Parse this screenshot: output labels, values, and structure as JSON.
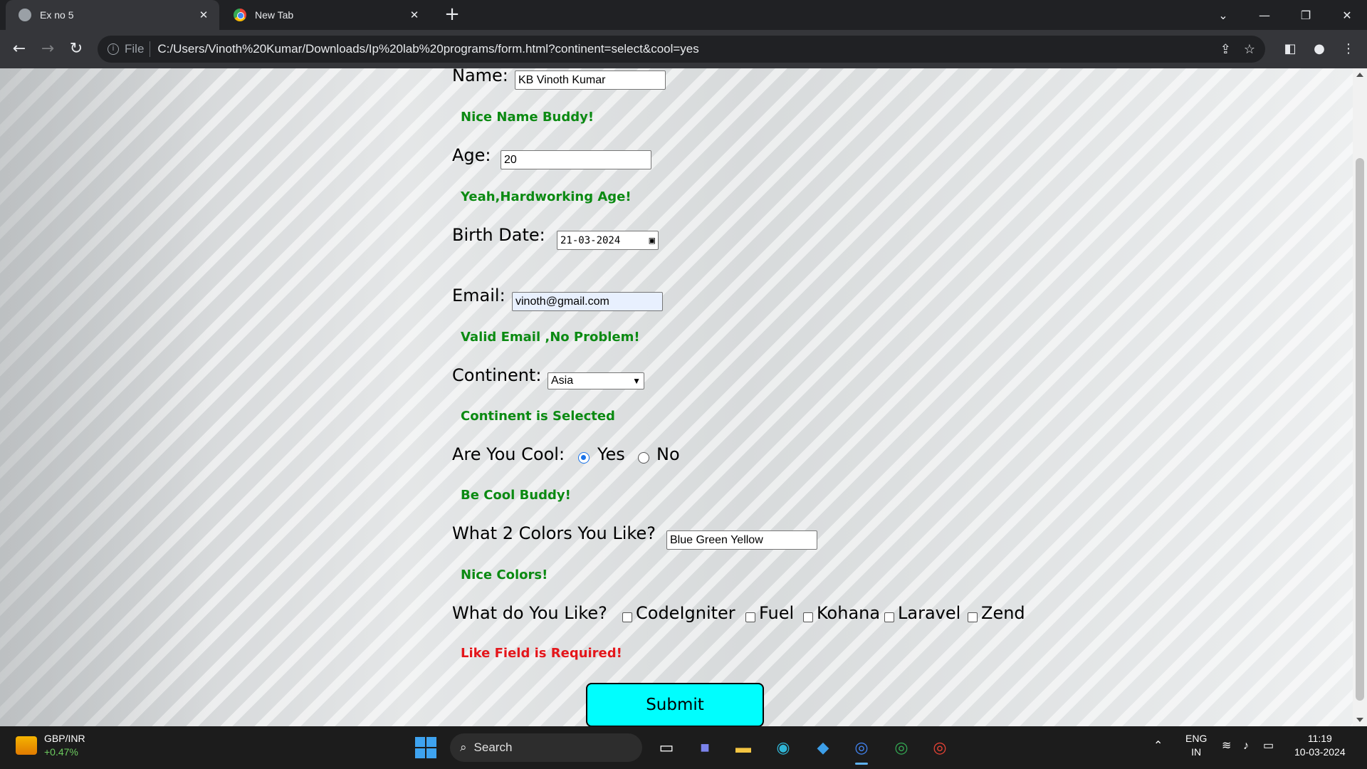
{
  "browser": {
    "tabs": [
      {
        "title": "Ex no 5",
        "active": true,
        "icon": "globe-icon"
      },
      {
        "title": "New Tab",
        "active": false,
        "icon": "chrome-icon"
      }
    ],
    "address": {
      "scheme_label": "File",
      "url": "C:/Users/Vinoth%20Kumar/Downloads/Ip%20lab%20programs/form.html?continent=select&cool=yes"
    }
  },
  "form": {
    "name": {
      "label": "Name:",
      "value": "KB Vinoth Kumar",
      "message": "Nice Name Buddy!"
    },
    "age": {
      "label": "Age:",
      "value": "20",
      "message": "Yeah,Hardworking Age!"
    },
    "birth_date": {
      "label": "Birth Date:",
      "value": "21-03-2024"
    },
    "email": {
      "label": "Email:",
      "value": "vinoth@gmail.com",
      "message": "Valid Email ,No Problem!"
    },
    "continent": {
      "label": "Continent:",
      "value": "Asia",
      "message": "Continent is Selected"
    },
    "cool": {
      "label": "Are You Cool:",
      "options": [
        "Yes",
        "No"
      ],
      "selected": "Yes",
      "message": "Be Cool Buddy!"
    },
    "colors": {
      "label": "What 2 Colors You Like?",
      "value": "Blue Green Yellow",
      "message": "Nice Colors!"
    },
    "likes": {
      "label": "What do You Like?",
      "options": [
        "CodeIgniter",
        "Fuel",
        "Kohana",
        "Laravel",
        "Zend"
      ],
      "message": "Like Field is Required!"
    },
    "submit_label": "Submit"
  },
  "taskbar": {
    "widget": {
      "title": "GBP/INR",
      "change": "+0.47%"
    },
    "search_placeholder": "Search",
    "language": {
      "line1": "ENG",
      "line2": "IN"
    },
    "clock": {
      "time": "11:19",
      "date": "10-03-2024"
    }
  },
  "colors": {
    "ok_message": "#0b8a12",
    "error_message": "#e4161b",
    "submit_button": "#00fefe",
    "radio_accent": "#1a73e8"
  }
}
